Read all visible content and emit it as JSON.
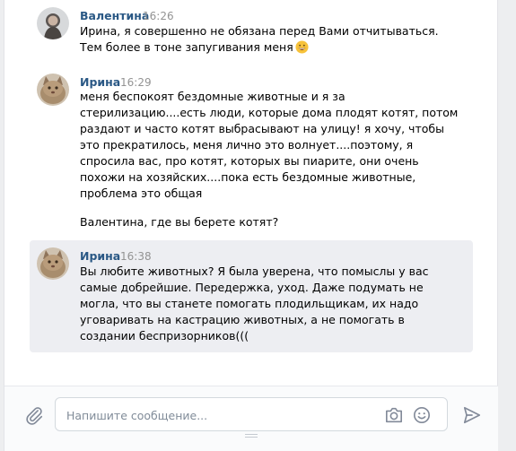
{
  "messages": [
    {
      "author": "Валентина",
      "time": "16:26",
      "text": "Ирина, я совершенно не обязана перед Вами отчитываться.\nТем более в тоне запугивания меня",
      "emoji": "grinning-face"
    },
    {
      "author": "Ирина",
      "time": "16:29",
      "text": "меня беспокоят бездомные животные и я за\nстерилизацию....есть люди, которые дома плодят котят, потом\nраздают и часто котят выбрасывают на улицу! я хочу, чтобы\nэто прекратилось, меня лично это волнует....поэтому, я\nспросила вас, про котят, которых вы пиарите, они очень\nпохожи на хозяйских....пока есть бездомные животные,\nпроблема это общая",
      "text2": "Валентина, где вы берете котят?"
    },
    {
      "author": "Ирина",
      "time": "16:38",
      "text": "Вы любите животных? Я была уверена, что помыслы у вас\nсамые добрейшие. Передержка, уход. Даже подумать не\nмогла, что вы станете помогать плодильщикам, их надо\nуговаривать на кастрацию животных, а не помогать в\nсоздании беспризорников((("
    }
  ],
  "composer": {
    "placeholder": "Напишите сообщение..."
  },
  "colors": {
    "author": "#2a5885",
    "time": "#939393",
    "highlight": "#edeef2",
    "icon": "#828a99"
  },
  "icons": [
    "paperclip-icon",
    "camera-icon",
    "smile-icon",
    "send-icon"
  ]
}
